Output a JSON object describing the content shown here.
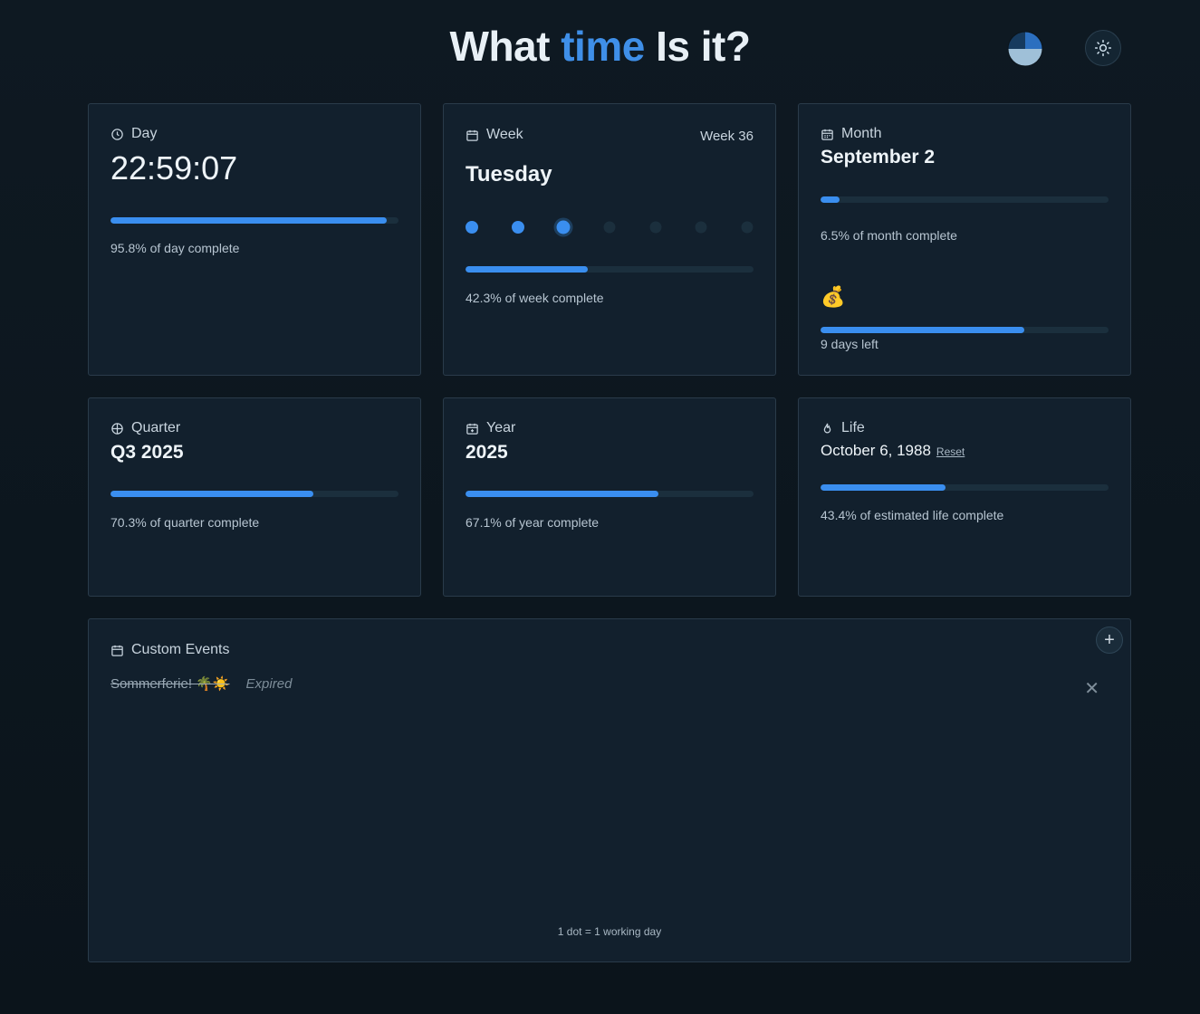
{
  "header": {
    "title_part1": "What ",
    "title_accent": "time",
    "title_part2": " Is it?",
    "theme_pie_icon": "pie-chart-icon",
    "theme_toggle_icon": "sun-icon"
  },
  "colors": {
    "accent": "#3a8eef",
    "background": "#0d1820",
    "card": "#12202d",
    "track": "#1b2f3d"
  },
  "day": {
    "label": "Day",
    "icon": "clock-icon",
    "time": "22:59:07",
    "progress": 95.8,
    "caption": "95.8% of day complete"
  },
  "week": {
    "label": "Week",
    "icon": "calendar-icon",
    "week_number": "Week 36",
    "weekday": "Tuesday",
    "dots": [
      "past",
      "past",
      "current",
      "future",
      "future",
      "future",
      "future"
    ],
    "progress": 42.3,
    "caption": "42.3% of week complete"
  },
  "month": {
    "label": "Month",
    "icon": "calendar-grid-icon",
    "date": "September 2",
    "progress": 6.5,
    "caption": "6.5% of month complete",
    "payday_icon": "money-bag-icon",
    "payday_emoji": "💰",
    "payday_progress": 70.6,
    "payday_caption": "9 days left"
  },
  "quarter": {
    "label": "Quarter",
    "icon": "crosshair-icon",
    "value": "Q3 2025",
    "progress": 70.3,
    "caption": "70.3% of quarter complete"
  },
  "year": {
    "label": "Year",
    "icon": "calendar-plus-icon",
    "value": "2025",
    "progress": 67.1,
    "caption": "67.1% of year complete"
  },
  "life": {
    "label": "Life",
    "icon": "flame-icon",
    "birthdate": "October 6, 1988",
    "reset_label": "Reset",
    "progress": 43.4,
    "caption": "43.4% of estimated life complete"
  },
  "custom_events": {
    "label": "Custom Events",
    "icon": "calendar-icon",
    "add_icon": "plus-icon",
    "add_label": "+",
    "events": [
      {
        "name": "Sommerferie! 🌴☀️",
        "status": "Expired"
      }
    ],
    "remove_label": "✕",
    "footnote": "1 dot = 1 working day"
  }
}
